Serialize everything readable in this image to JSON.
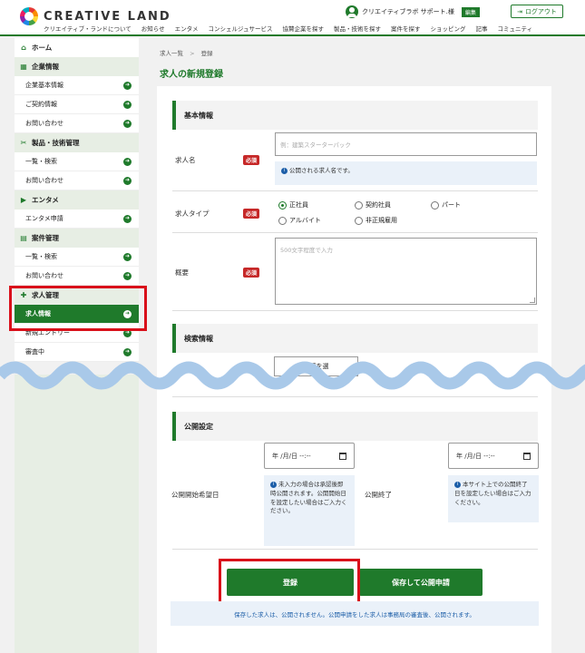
{
  "header": {
    "logo_text": "CREATIVE LAND",
    "user_name": "クリエイティブラボ サポート.様",
    "edit_badge": "編集",
    "logout_label": "ログアウト",
    "nav": [
      "クリエイティブ・ランドについて",
      "お知らせ",
      "エンタメ",
      "コンシェルジュサービス",
      "協賛企業を探す",
      "製品・技術を探す",
      "案件を探す",
      "ショッピング",
      "記事",
      "コミュニティ"
    ]
  },
  "sidebar": {
    "home": "ホーム",
    "company": {
      "title": "企業情報",
      "items": [
        "企業基本情報",
        "ご契約情報",
        "お問い合わせ"
      ]
    },
    "products": {
      "title": "製品・技術管理",
      "items": [
        "一覧・検索",
        "お問い合わせ"
      ]
    },
    "entame": {
      "title": "エンタメ",
      "items": [
        "エンタメ申請"
      ]
    },
    "cases": {
      "title": "案件管理",
      "items": [
        "一覧・検索",
        "お問い合わせ"
      ]
    },
    "jobs": {
      "title": "求人管理",
      "items": [
        "求人情報",
        "新規エントリー",
        "審査中"
      ]
    }
  },
  "breadcrumb": {
    "parent": "求人一覧",
    "sep": ">",
    "current": "登録"
  },
  "page_title": "求人の新規登録",
  "form": {
    "basic_title": "基本情報",
    "required": "必須",
    "name_label": "求人名",
    "name_placeholder": "例：建築スターターパック",
    "name_hint": "公開される求人名です。",
    "type_label": "求人タイプ",
    "types": [
      "正社員",
      "契約社員",
      "パート",
      "アルバイト",
      "非正規雇用"
    ],
    "summary_label": "概要",
    "summary_placeholder": "500文字程度で入力",
    "search_title": "検索情報",
    "select_button": "職種を選",
    "publish_title": "公開設定",
    "start_label": "公開開始希望日",
    "end_label": "公開終了",
    "date_placeholder": "年 /月/日 --:--",
    "start_hint": "未入力の場合は承認後即時公開されます。公開開始日を設定したい場合はご入力ください。",
    "end_hint": "本サイト上での公開終了日を設定したい場合はご入力ください。",
    "register_button": "登録",
    "save_apply_button": "保存して公開申請",
    "notice": "保存した求人は、公開されません。公開申請をした求人は事務局の審査後、公開されます。"
  },
  "colors": {
    "brand_green": "#1f7a2b",
    "highlight_red": "#d9101a",
    "required_red": "#c62828",
    "info_blue": "#1c5ea8"
  }
}
